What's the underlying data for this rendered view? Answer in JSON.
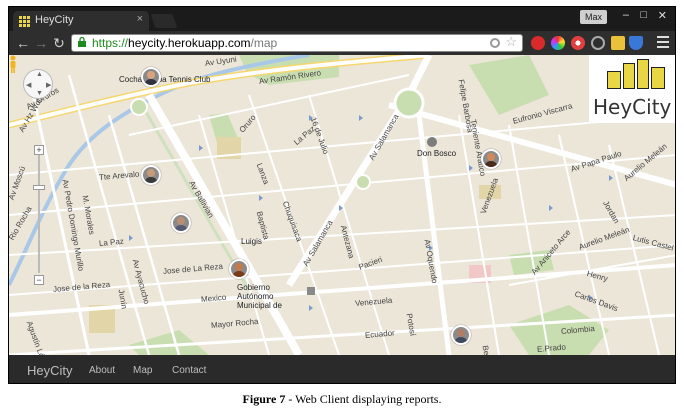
{
  "browser": {
    "tab_title": "HeyCity",
    "tab_close": "×",
    "user_badge": "Max",
    "window_controls": [
      "–",
      "□",
      "✕"
    ],
    "back_icon": "arrow-left-icon",
    "forward_icon": "arrow-right-icon",
    "reload_icon": "reload-icon",
    "url_secure_part": "https://",
    "url_host": "heycity.herokuapp.com",
    "url_path": "/map",
    "extension_icons": [
      "opera-icon",
      "color-wheel-icon",
      "flower-icon",
      "clock-icon",
      "home-icon",
      "shield-icon"
    ]
  },
  "map": {
    "streets": [
      {
        "text": "Av Uyuni"
      },
      {
        "text": "Av Ramón Rivero"
      },
      {
        "text": "Oruro"
      },
      {
        "text": "La Paz"
      },
      {
        "text": "16 de Julio"
      },
      {
        "text": "Av Salamanca"
      },
      {
        "text": "Eufronio Viscarra"
      },
      {
        "text": "Av Papa Paulo"
      },
      {
        "text": "Aurelio Meleán"
      },
      {
        "text": "Teniente Arauco"
      },
      {
        "text": "Av Ballivian"
      },
      {
        "text": "Lanza"
      },
      {
        "text": "Baptista"
      },
      {
        "text": "Chuquisaca"
      },
      {
        "text": "Antezana"
      },
      {
        "text": "Av Salamanca"
      },
      {
        "text": "Pacieri"
      },
      {
        "text": "Av Oquendo"
      },
      {
        "text": "Venezuela"
      },
      {
        "text": "Av Aniceto Arce"
      },
      {
        "text": "Aurelio Meleán"
      },
      {
        "text": "Lutis Castel"
      },
      {
        "text": "Henry"
      },
      {
        "text": "Carlos Davis"
      },
      {
        "text": "Jose de la Reza"
      },
      {
        "text": "Jose de La Reza"
      },
      {
        "text": "Mexico"
      },
      {
        "text": "Venezuela"
      },
      {
        "text": "Mayor Rocha"
      },
      {
        "text": "Ecuador"
      },
      {
        "text": "Colombia"
      },
      {
        "text": "E.Prado"
      },
      {
        "text": "Av Ayacucho"
      },
      {
        "text": "Junín"
      },
      {
        "text": "La Paz"
      },
      {
        "text": "Tte Arevalo"
      },
      {
        "text": "Av Pedro Domingo Murillo"
      },
      {
        "text": "M. Morales"
      },
      {
        "text": "Rio Rocha"
      },
      {
        "text": "Av Hz Wolter"
      },
      {
        "text": "Av Oruros"
      },
      {
        "text": "Agustín López"
      },
      {
        "text": "Av Moscú"
      },
      {
        "text": "Felipe Barbosa"
      },
      {
        "text": "Jordan"
      },
      {
        "text": "Beni"
      },
      {
        "text": "Potosí"
      }
    ],
    "pois": [
      {
        "text": "Cochabamba Tennis Club"
      },
      {
        "text": "Don Bosco"
      },
      {
        "text": "Luigis"
      },
      {
        "text": "Gobierno Autónomo Municipal de"
      }
    ],
    "markers": [
      {
        "name": "marker-1",
        "skin": "#d9a27c",
        "shirt": "#303040"
      },
      {
        "name": "marker-2",
        "skin": "#c79a7a",
        "shirt": "#3a3a3a"
      },
      {
        "name": "marker-3",
        "skin": "#b98e74",
        "shirt": "#555a70"
      },
      {
        "name": "marker-4",
        "skin": "#c67a4c",
        "shirt": "#7a3b1a"
      },
      {
        "name": "marker-5",
        "skin": "#d08a5a",
        "shirt": "#4a2a1a"
      },
      {
        "name": "marker-6",
        "skin": "#b07e66",
        "shirt": "#404a5e"
      }
    ]
  },
  "app": {
    "logo_text": "HeyCity",
    "brand": "HeyCity",
    "nav": [
      "About",
      "Map",
      "Contact"
    ]
  },
  "caption": {
    "label": "Figure 7",
    "text": " - Web Client displaying reports."
  },
  "colors": {
    "map_bg": "#ece6d9",
    "road": "#ffffff",
    "park": "#c9deb0",
    "logo_yellow": "#e8d645"
  }
}
